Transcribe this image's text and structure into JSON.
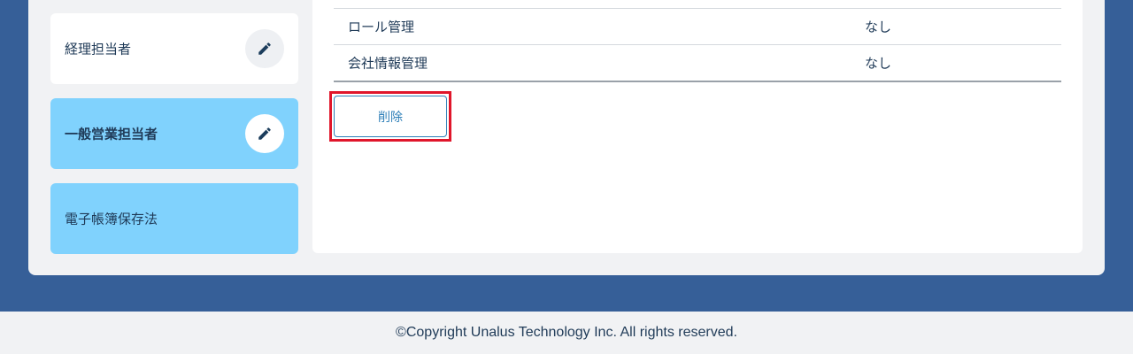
{
  "roles": [
    {
      "label": "経理担当者",
      "bg": "#ffffff",
      "selected": false,
      "has_edit": true
    },
    {
      "label": "一般営業担当者",
      "bg": "#80d2fd",
      "selected": true,
      "has_edit": true
    },
    {
      "label": "電子帳簿保存法",
      "bg": "#80d2fd",
      "selected": false,
      "has_edit": false
    }
  ],
  "permissions": [
    {
      "name": "ロール管理",
      "value": "なし"
    },
    {
      "name": "会社情報管理",
      "value": "なし"
    }
  ],
  "actions": {
    "delete_label": "削除"
  },
  "footer": {
    "copyright": "©Copyright Unalus Technology Inc. All rights reserved."
  },
  "colors": {
    "page_bg": "#365f98",
    "accent": "#2e7fb8",
    "selected_card": "#80d2fd",
    "highlight": "#e0162b"
  },
  "icons": {
    "edit": "pencil-icon"
  }
}
